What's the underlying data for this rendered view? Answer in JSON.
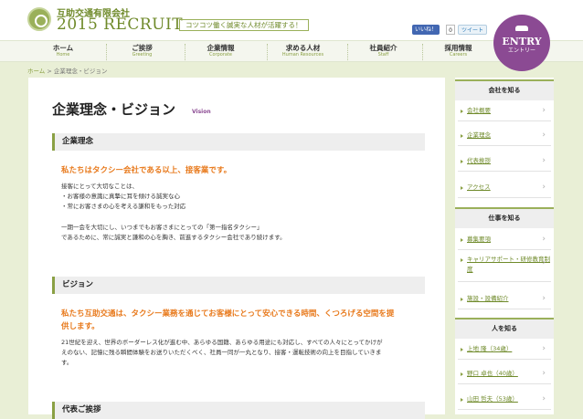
{
  "header": {
    "company": "互助交通有限会社",
    "title": "2015 RECRUIT",
    "tagline": "コツコツ働く誠実な人材が活躍する！",
    "like_label": "いいね！",
    "like_count": "0",
    "tweet_label": "ツイート"
  },
  "nav": [
    {
      "label": "ホーム",
      "sub": "Home"
    },
    {
      "label": "ご挨拶",
      "sub": "Greeting"
    },
    {
      "label": "企業情報",
      "sub": "Corporate"
    },
    {
      "label": "求める人材",
      "sub": "Human Resources"
    },
    {
      "label": "社員紹介",
      "sub": "Staff"
    },
    {
      "label": "採用情報",
      "sub": "Careers"
    }
  ],
  "entry": {
    "label": "ENTRY",
    "sub": "エントリー"
  },
  "breadcrumb": {
    "home": "ホーム",
    "sep": ">",
    "current": "企業理念・ビジョン"
  },
  "main": {
    "title": "企業理念・ビジョン",
    "title_en": "Vision",
    "philosophy": {
      "heading": "企業理念",
      "lead": "私たちはタクシー会社である以上、接客業です。",
      "p1": [
        "接客にとって大切なことは、",
        "・お客様の意識に真摯に耳を傾ける誠実な心",
        "・常にお客さまの心を考える謙和をもった対応"
      ],
      "p2": [
        "一期一会を大切にし、いつまでもお客さまにとっての「第一指名タクシー」",
        "であるために、常に誠実と謙和の心を胸き、前進するタクシー会社であり続けます。"
      ]
    },
    "vision": {
      "heading": "ビジョン",
      "lead": [
        "私たち互助交通は、タクシー業務を通じてお客様にとって安心できる時間、くつろげる空間を提",
        "供します。"
      ],
      "p1": [
        "21世紀を迎え、世界のボーダーレス化が進む中、あらゆる国籍、あらゆる用途にも対応し、すべての人々にとってかけが",
        "えのない、記憶に残る瞬間体験をお送りいただくべく、社員一同が一丸となり、接客・運転技術の向上を目指していきま",
        "す。"
      ]
    },
    "greeting": {
      "heading": "代表ご挨拶"
    }
  },
  "sidebar": {
    "sections": [
      {
        "heading": "会社を知る",
        "items": [
          "会社概要",
          "企業理念",
          "代表挨拶",
          "アクセス"
        ]
      },
      {
        "heading": "仕事を知る",
        "items": [
          "募集要項",
          "キャリアサポート・研修教育制度",
          "施設・設備紹介"
        ]
      },
      {
        "heading": "人を知る",
        "items": [
          "上地 隆（34歳）",
          "野口 卓也（40歳）",
          "山田 哲夫（53歳）"
        ]
      }
    ]
  },
  "colors": {
    "accent": "#8aa044",
    "brand_purple": "#8b4a93",
    "lead_orange": "#e87a1d",
    "background": "#e9efd6"
  }
}
